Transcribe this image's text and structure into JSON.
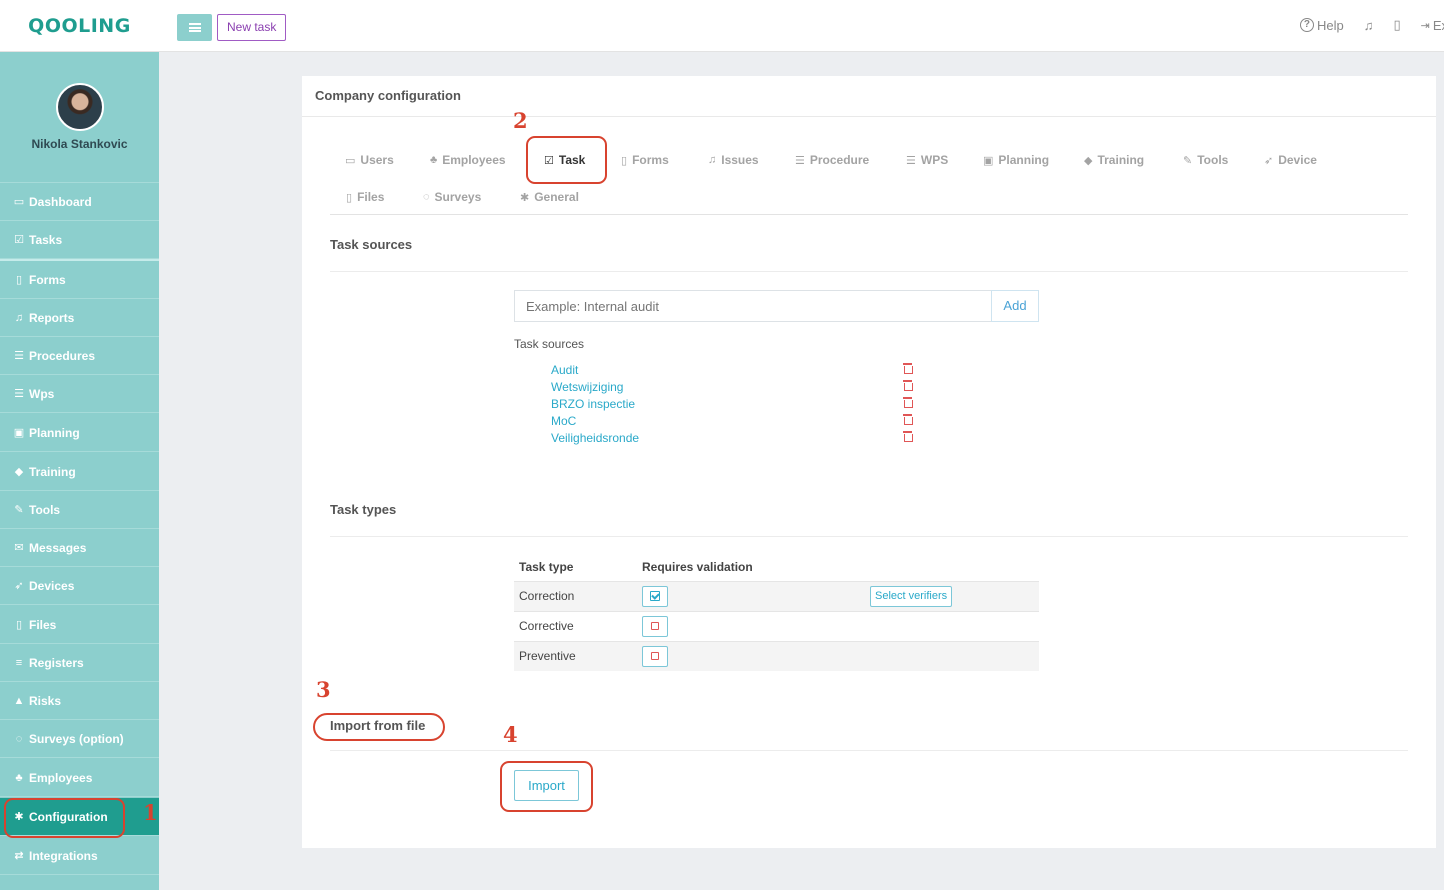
{
  "brand": {
    "logo_text": "QOOLING",
    "accent": "#1f9d8f",
    "sidebar_bg": "#8ccfcd"
  },
  "topbar": {
    "menu_icon": "hamburger-icon",
    "new_task_label": "New task",
    "help_label": "Help",
    "exit_label": "Ex"
  },
  "sidebar": {
    "user_name": "Nikola Stankovic",
    "items": [
      {
        "label": "Dashboard",
        "icon": "monitor-icon",
        "glyph": "▭"
      },
      {
        "label": "Tasks",
        "icon": "check-square-icon",
        "glyph": "☑"
      },
      {
        "label": "Forms",
        "icon": "file-icon",
        "glyph": "▯"
      },
      {
        "label": "Reports",
        "icon": "bell-icon",
        "glyph": "♫"
      },
      {
        "label": "Procedures",
        "icon": "list-icon",
        "glyph": "☰"
      },
      {
        "label": "Wps",
        "icon": "list-icon",
        "glyph": "☰"
      },
      {
        "label": "Planning",
        "icon": "calendar-icon",
        "glyph": "▣"
      },
      {
        "label": "Training",
        "icon": "graduation-cap-icon",
        "glyph": "◆"
      },
      {
        "label": "Tools",
        "icon": "wrench-icon",
        "glyph": "✎"
      },
      {
        "label": "Messages",
        "icon": "envelope-icon",
        "glyph": "✉"
      },
      {
        "label": "Devices",
        "icon": "rocket-icon",
        "glyph": "➶"
      },
      {
        "label": "Files",
        "icon": "file-icon",
        "glyph": "▯"
      },
      {
        "label": "Registers",
        "icon": "list-icon",
        "glyph": "≡"
      },
      {
        "label": "Risks",
        "icon": "warning-icon",
        "glyph": "▲"
      },
      {
        "label": "Surveys (option)",
        "icon": "comment-icon",
        "glyph": "◌"
      },
      {
        "label": "Employees",
        "icon": "users-icon",
        "glyph": "♣"
      },
      {
        "label": "Configuration",
        "icon": "gear-icon",
        "glyph": "✱"
      },
      {
        "label": "Integrations",
        "icon": "exchange-icon",
        "glyph": "⇄"
      }
    ]
  },
  "page": {
    "title": "Company configuration",
    "tabs": [
      {
        "label": "Users",
        "icon": "id-card-icon",
        "glyph": "▭"
      },
      {
        "label": "Employees",
        "icon": "users-icon",
        "glyph": "♣"
      },
      {
        "label": "Task",
        "icon": "check-square-icon",
        "glyph": "☑"
      },
      {
        "label": "Forms",
        "icon": "file-icon",
        "glyph": "▯"
      },
      {
        "label": "Issues",
        "icon": "bell-icon",
        "glyph": "♫"
      },
      {
        "label": "Procedure",
        "icon": "list-icon",
        "glyph": "☰"
      },
      {
        "label": "WPS",
        "icon": "list-icon",
        "glyph": "☰"
      },
      {
        "label": "Planning",
        "icon": "calendar-icon",
        "glyph": "▣"
      },
      {
        "label": "Training",
        "icon": "graduation-cap-icon",
        "glyph": "◆"
      },
      {
        "label": "Tools",
        "icon": "wrench-icon",
        "glyph": "✎"
      },
      {
        "label": "Device",
        "icon": "rocket-icon",
        "glyph": "➶"
      },
      {
        "label": "Files",
        "icon": "file-icon",
        "glyph": "▯"
      },
      {
        "label": "Surveys",
        "icon": "comment-icon",
        "glyph": "◌"
      },
      {
        "label": "General",
        "icon": "gear-icon",
        "glyph": "✱"
      }
    ],
    "task_sources": {
      "section_title": "Task sources",
      "input_placeholder": "Example: Internal audit",
      "add_label": "Add",
      "list_label": "Task sources",
      "items": [
        "Audit",
        "Wetswijziging",
        "BRZO inspectie",
        "MoC",
        "Veiligheidsronde"
      ]
    },
    "task_types": {
      "section_title": "Task types",
      "col_type": "Task type",
      "col_validation": "Requires validation",
      "select_verifiers_label": "Select verifiers",
      "rows": [
        {
          "name": "Correction",
          "requires_validation": true
        },
        {
          "name": "Corrective",
          "requires_validation": false
        },
        {
          "name": "Preventive",
          "requires_validation": false
        }
      ]
    },
    "import": {
      "section_title": "Import from file",
      "button_label": "Import"
    }
  },
  "annotations": {
    "color": "#d8432f",
    "numbers": [
      "1",
      "2",
      "3",
      "4"
    ]
  }
}
